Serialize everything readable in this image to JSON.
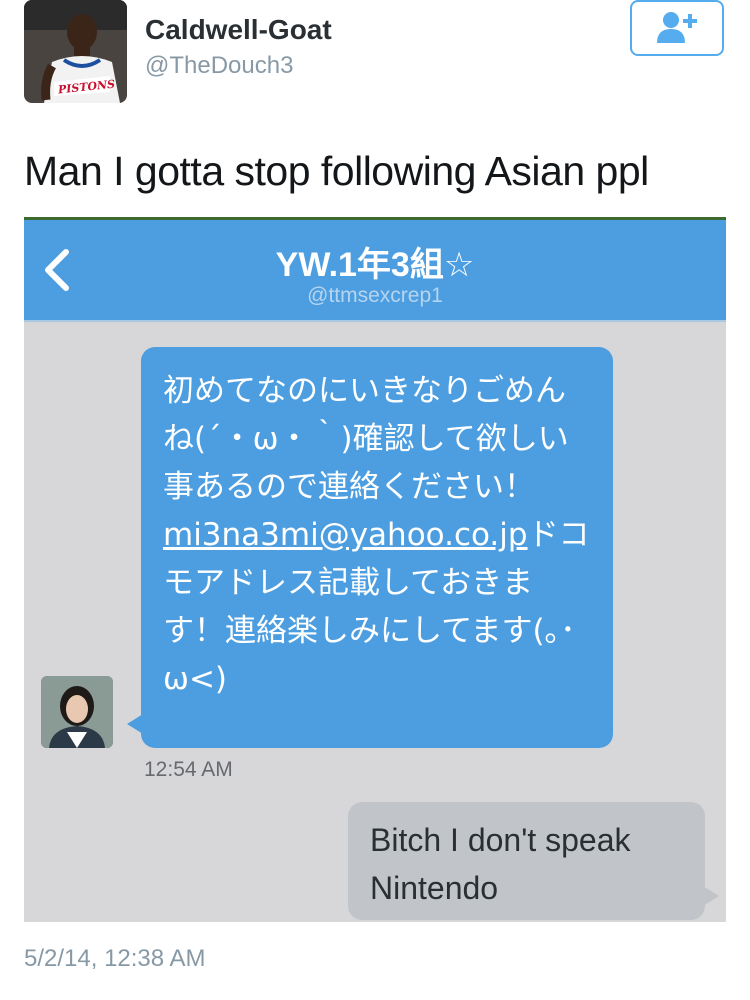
{
  "author": {
    "display_name": "Caldwell-Goat",
    "handle": "@TheDouch3",
    "avatar_icon": "player-photo-avatar",
    "avatar_jersey_text": "PISTONS"
  },
  "follow_button": {
    "icon": "follow-user-icon",
    "color": "#55acee"
  },
  "tweet": {
    "text": "Man I gotta stop following Asian ppl",
    "timestamp": "5/2/14, 12:38 AM"
  },
  "embedded_screenshot": {
    "header": {
      "title": "YW.1年3組☆",
      "handle": "@ttmsexcrep1",
      "back_icon": "chevron-left-icon",
      "color": "#4d9ee0"
    },
    "messages": [
      {
        "direction": "incoming",
        "avatar_icon": "woman-photo-avatar",
        "text_before": "初めてなのにいきなりごめんね(´・ω・｀)確認して欲しい事あるので連絡ください！",
        "email": "mi3na3mi@yahoo.co.jp",
        "text_after": "ドコモアドレス記載しておきます！連絡楽しみにしてます(｡･ω<)",
        "time": "12:54 AM"
      },
      {
        "direction": "outgoing",
        "text": "Bitch I don't speak Nintendo"
      }
    ]
  }
}
